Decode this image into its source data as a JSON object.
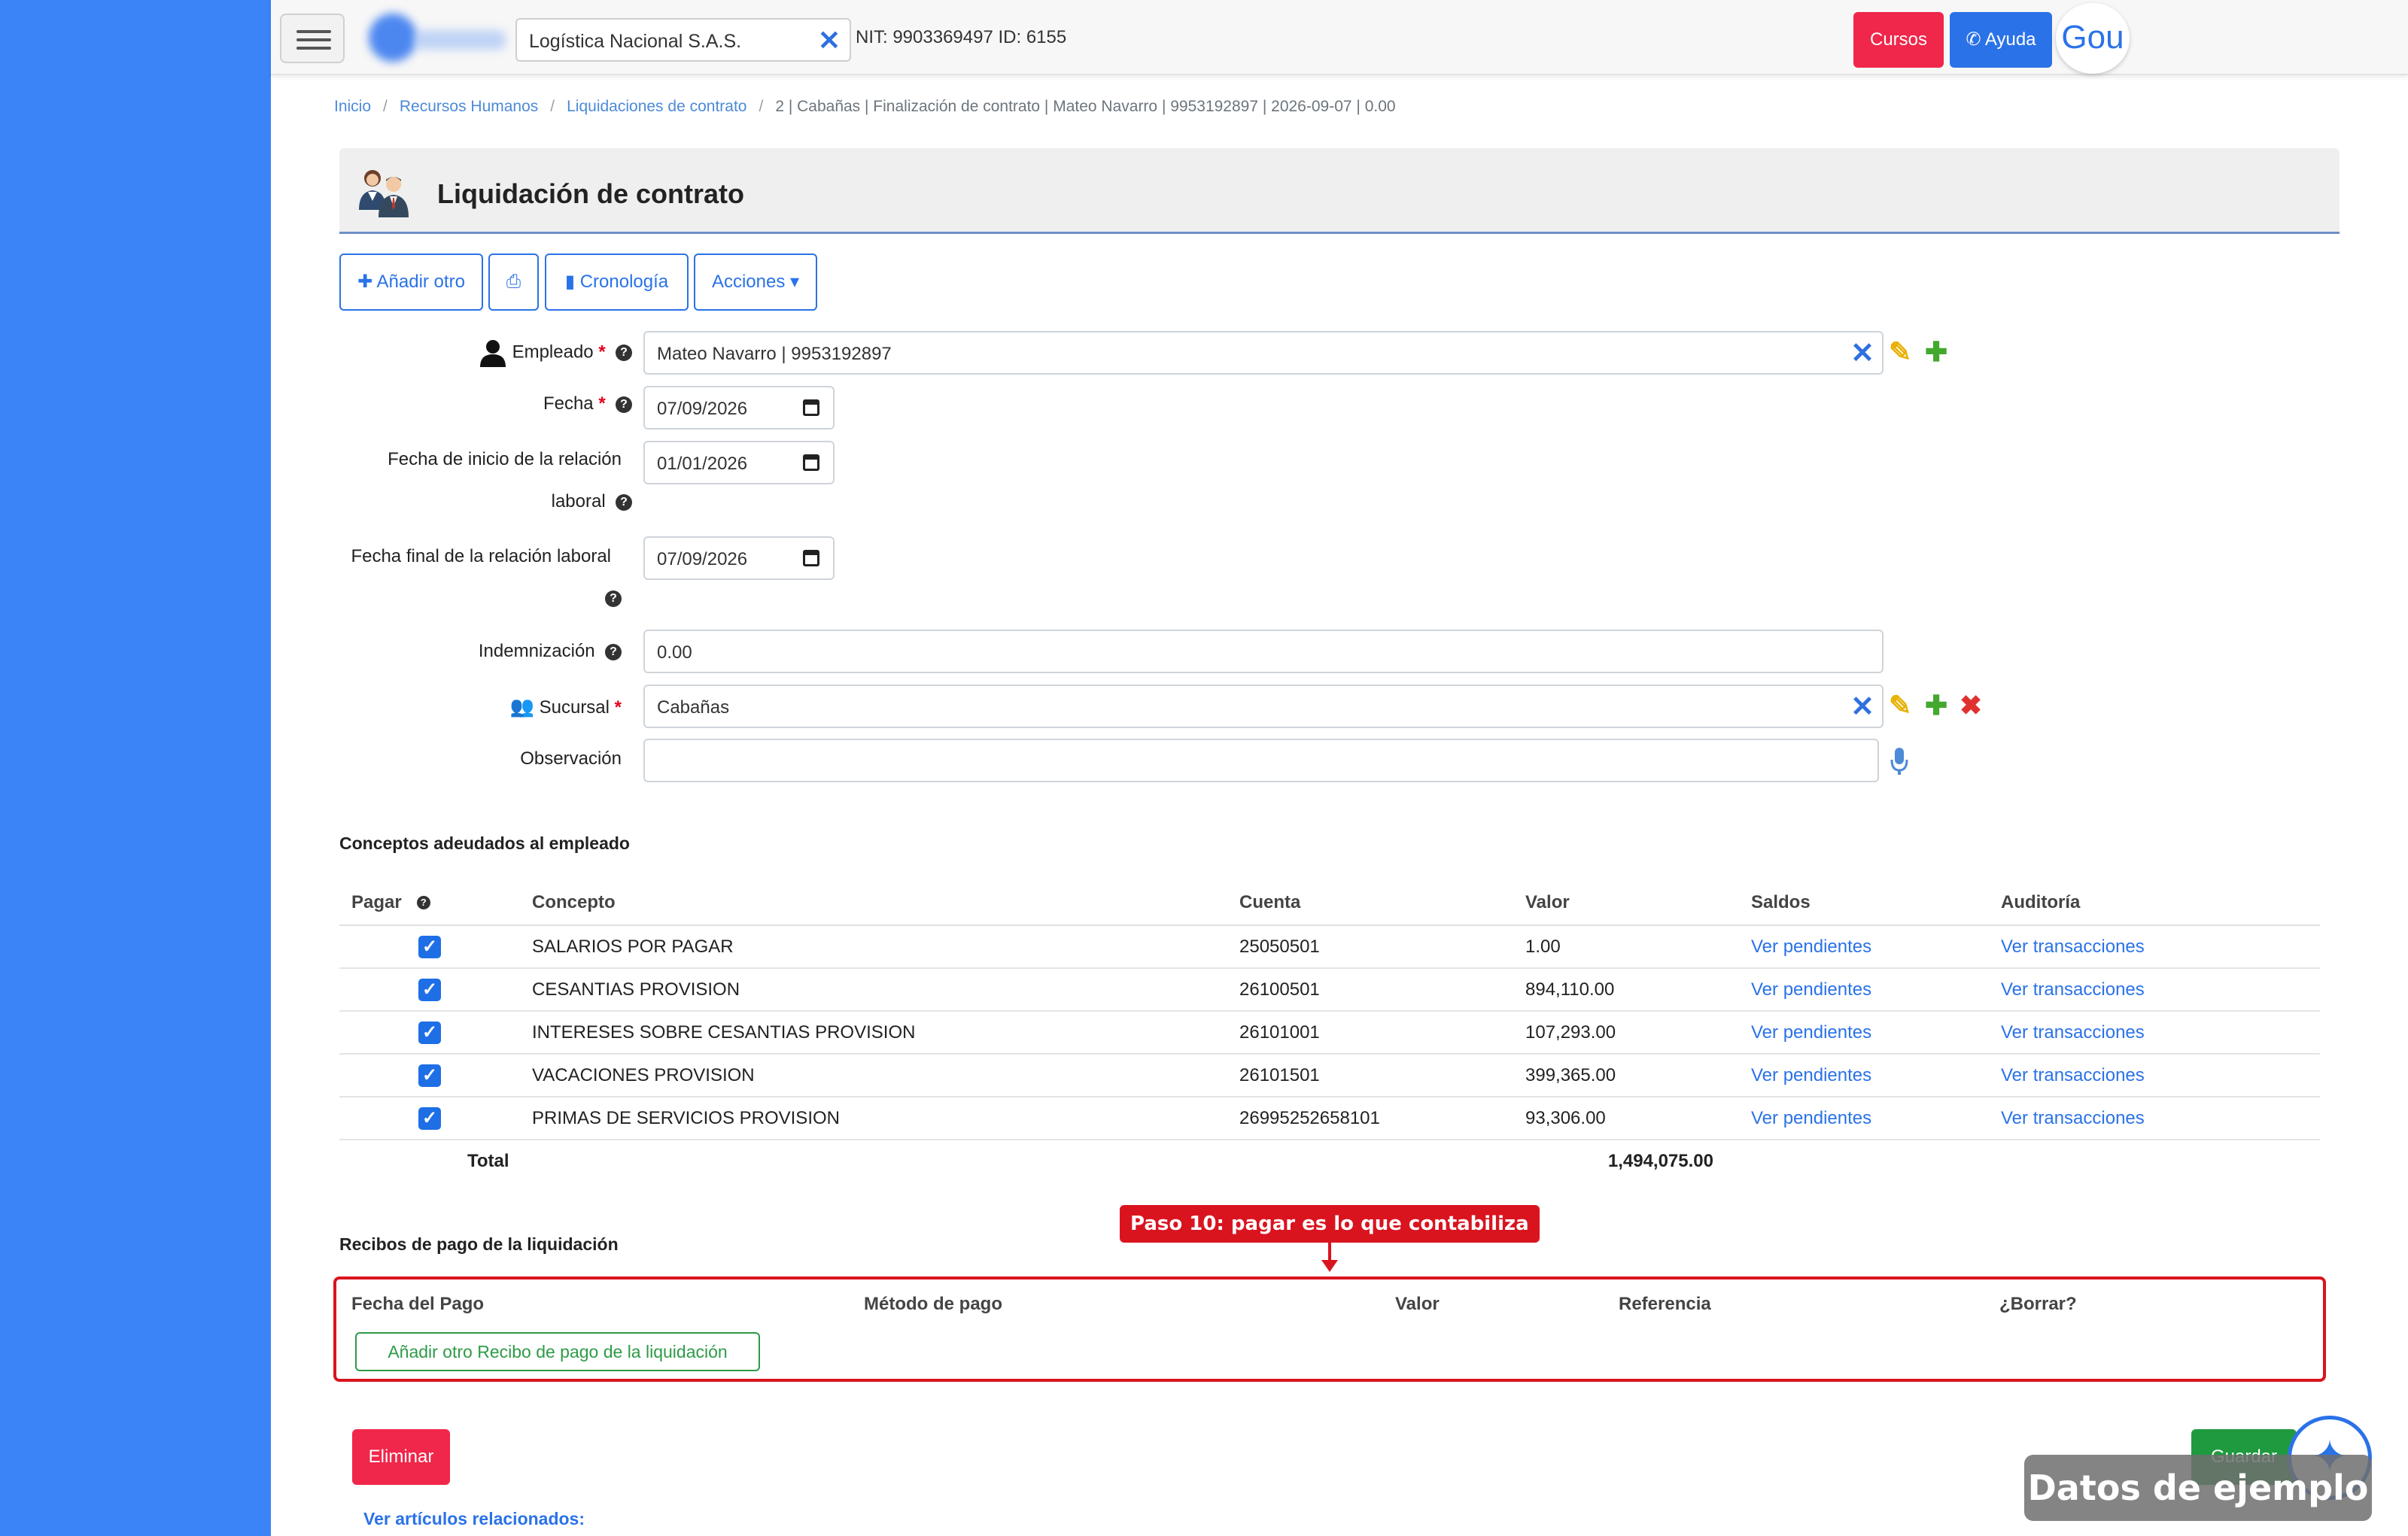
{
  "topbar": {
    "company": "Logística Nacional S.A.S.",
    "nit_text": "NIT: 9903369497 ID: 6155",
    "cursos_label": "Cursos",
    "ayuda_label": "Ayuda",
    "gou_label": "Gou"
  },
  "breadcrumb": {
    "items": [
      "Inicio",
      "Recursos Humanos",
      "Liquidaciones de contrato"
    ],
    "current": "2 | Cabañas | Finalización de contrato | Mateo Navarro | 9953192897 | 2026-09-07 | 0.00"
  },
  "page": {
    "title": "Liquidación de contrato"
  },
  "toolbar": {
    "add_label": "Añadir otro",
    "chrono_label": "Cronología",
    "actions_label": "Acciones"
  },
  "form": {
    "empleado": {
      "label": "Empleado",
      "value": "Mateo Navarro | 9953192897"
    },
    "fecha": {
      "label": "Fecha",
      "value": "07/09/2026"
    },
    "fecha_inicio": {
      "label_line1": "Fecha de inicio de la relación",
      "label_line2": "laboral",
      "value": "01/01/2026"
    },
    "fecha_final": {
      "label": "Fecha final de la relación laboral",
      "value": "07/09/2026"
    },
    "indemnizacion": {
      "label": "Indemnización",
      "value": "0.00"
    },
    "sucursal": {
      "label": "Sucursal",
      "value": "Cabañas"
    },
    "observacion": {
      "label": "Observación",
      "value": ""
    }
  },
  "conceptos": {
    "title": "Conceptos adeudados al empleado",
    "headers": [
      "Pagar",
      "Concepto",
      "Cuenta",
      "Valor",
      "Saldos",
      "Auditoría"
    ],
    "rows": [
      {
        "concepto": "SALARIOS POR PAGAR",
        "cuenta": "25050501",
        "valor": "1.00",
        "saldos": "Ver pendientes",
        "auditoria": "Ver transacciones"
      },
      {
        "concepto": "CESANTIAS PROVISION",
        "cuenta": "26100501",
        "valor": "894,110.00",
        "saldos": "Ver pendientes",
        "auditoria": "Ver transacciones"
      },
      {
        "concepto": "INTERESES SOBRE CESANTIAS PROVISION",
        "cuenta": "26101001",
        "valor": "107,293.00",
        "saldos": "Ver pendientes",
        "auditoria": "Ver transacciones"
      },
      {
        "concepto": "VACACIONES PROVISION",
        "cuenta": "26101501",
        "valor": "399,365.00",
        "saldos": "Ver pendientes",
        "auditoria": "Ver transacciones"
      },
      {
        "concepto": "PRIMAS DE SERVICIOS PROVISION",
        "cuenta": "26995252658101",
        "valor": "93,306.00",
        "saldos": "Ver pendientes",
        "auditoria": "Ver transacciones"
      }
    ],
    "total_label": "Total",
    "total_value": "1,494,075.00"
  },
  "recibos": {
    "title": "Recibos de pago de la liquidación",
    "headers": [
      "Fecha del Pago",
      "Método de pago",
      "Valor",
      "Referencia",
      "¿Borrar?"
    ],
    "add_label": "Añadir otro Recibo de pago de la liquidación"
  },
  "annotation": {
    "text": "Paso 10: pagar es lo que contabiliza"
  },
  "footer": {
    "eliminar_label": "Eliminar",
    "guardar_label": "Guardar",
    "related_label": "Ver artículos relacionados:"
  },
  "watermark": "Datos de ejemplo",
  "colors": {
    "sidebar": "#3a84f7",
    "primary": "#2a72e8",
    "danger": "#f0264a",
    "success": "#1f9a3f",
    "annotation": "#d9141f"
  }
}
